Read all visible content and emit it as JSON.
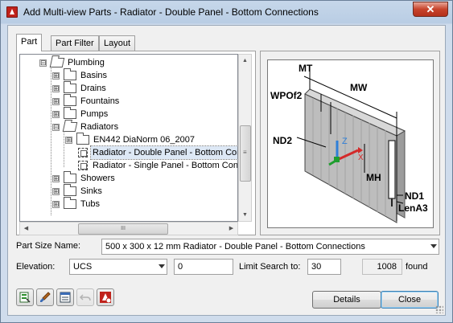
{
  "window": {
    "title": "Add Multi-view Parts - Radiator - Double Panel - Bottom Connections",
    "close_glyph": "✕"
  },
  "tabs": [
    {
      "label": "Part",
      "active": true
    },
    {
      "label": "Part Filter",
      "active": false
    },
    {
      "label": "Layout",
      "active": false
    }
  ],
  "tree": {
    "items": [
      {
        "label": "Plumbing",
        "expander": "⊟",
        "icon": "folder-open-icon"
      },
      {
        "label": "Basins",
        "expander": "⊞",
        "icon": "folder-icon"
      },
      {
        "label": "Drains",
        "expander": "⊞",
        "icon": "folder-icon"
      },
      {
        "label": "Fountains",
        "expander": "⊞",
        "icon": "folder-icon"
      },
      {
        "label": "Pumps",
        "expander": "⊞",
        "icon": "folder-icon"
      },
      {
        "label": "Radiators",
        "expander": "⊟",
        "icon": "folder-open-icon"
      },
      {
        "label": "EN442 DiaNorm 06_2007",
        "expander": "⊞",
        "icon": "folder-icon"
      },
      {
        "label": "Radiator - Double Panel - Bottom Connections",
        "expander": "",
        "icon": "part-icon",
        "selected": true
      },
      {
        "label": "Radiator - Single Panel - Bottom Connections",
        "expander": "",
        "icon": "part-icon"
      },
      {
        "label": "Showers",
        "expander": "⊞",
        "icon": "folder-icon"
      },
      {
        "label": "Sinks",
        "expander": "⊞",
        "icon": "folder-icon"
      },
      {
        "label": "Tubs",
        "expander": "⊞",
        "icon": "folder-icon"
      }
    ],
    "scroll_up": "▲",
    "scroll_down": "▼",
    "scroll_left": "◀",
    "scroll_right": "▶",
    "thumb_grip": "≡",
    "hthumb_grip": "III"
  },
  "preview": {
    "labels": {
      "mt": "MT",
      "mw": "MW",
      "wpof2": "WPOf2",
      "nd2": "ND2",
      "mh": "MH",
      "nd1": "ND1",
      "lena3": "LenA3",
      "axis_z": "Z",
      "axis_x": "X"
    },
    "colors": {
      "panel": "#b9b9b9",
      "panel_dark": "#8a8a8a",
      "axis_z": "#2f7fd8",
      "axis_x": "#d42a2a",
      "axis_y": "#1f9e2f"
    }
  },
  "form": {
    "part_size_label": "Part Size Name:",
    "part_size_value": "500 x 300 x 12 mm Radiator - Double Panel - Bottom Connections",
    "elevation_label": "Elevation:",
    "elevation_value": "UCS",
    "elevation_input": "0",
    "limit_label": "Limit Search to:",
    "limit_value": "30",
    "found_count": "1008",
    "found_label": "found"
  },
  "toolbar": {
    "icons": [
      "catalog-browse-icon",
      "style-brush-icon",
      "properties-list-icon",
      "undo-arrow-icon",
      "autocad-mep-icon"
    ]
  },
  "buttons": {
    "details": "Details",
    "close": "Close"
  }
}
